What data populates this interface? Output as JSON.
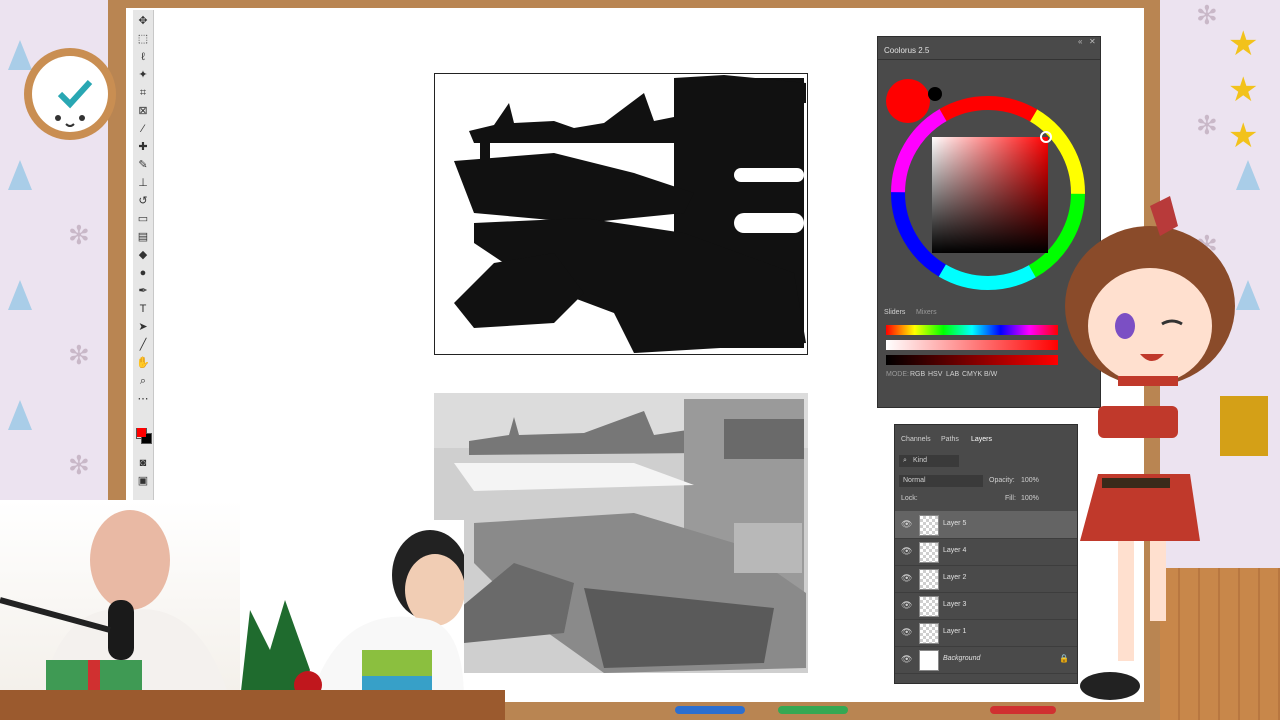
{
  "coolorus": {
    "title": "Coolorus 2.5",
    "tabs": [
      "Sliders",
      "Mixers"
    ],
    "mode_label": "MODE:",
    "modes": [
      "RGB",
      "HSV",
      "LAB",
      "CMYK",
      "B/W"
    ],
    "current_color": "#ff0000"
  },
  "layers_panel": {
    "tabs": [
      "Channels",
      "Paths",
      "Layers"
    ],
    "filter_label": "Kind",
    "blend_mode": "Normal",
    "opacity_label": "Opacity:",
    "opacity_value": "100%",
    "lock_label": "Lock:",
    "fill_label": "Fill:",
    "fill_value": "100%",
    "layers": [
      {
        "name": "Layer 5",
        "selected": true
      },
      {
        "name": "Layer 4",
        "selected": false
      },
      {
        "name": "Layer 2",
        "selected": false
      },
      {
        "name": "Layer 3",
        "selected": false
      },
      {
        "name": "Layer 1",
        "selected": false
      },
      {
        "name": "Background",
        "selected": false
      }
    ]
  },
  "colors": {
    "foreground": "#ff0000",
    "background": "#000000",
    "panel_bg": "#4a4a4a",
    "frame_wood": "#b98552"
  }
}
